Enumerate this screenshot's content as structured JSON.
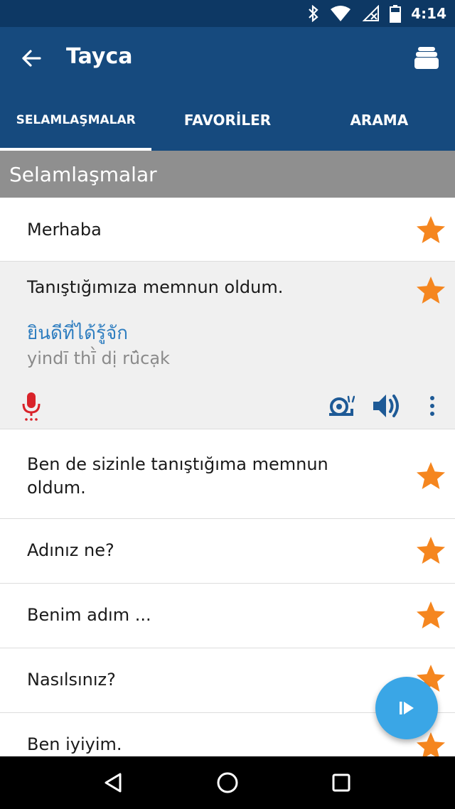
{
  "status_bar": {
    "time": "4:14"
  },
  "app_bar": {
    "title": "Tayca"
  },
  "tabs": [
    {
      "label": "SELAMLAŞMALAR",
      "active": true
    },
    {
      "label": "FAVORİLER",
      "active": false
    },
    {
      "label": "ARAMA",
      "active": false
    }
  ],
  "section_title": "Selamlaşmalar",
  "phrases": [
    {
      "text": "Merhaba"
    },
    {
      "text": "Tanıştığımıza memnun oldum.",
      "thai": "ยินดีที่ได้รู้จัก",
      "translit": "yindī thī̀ dị rū̂cạk"
    },
    {
      "text": "Ben de sizinle tanıştığıma memnun oldum."
    },
    {
      "text": "Adınız ne?"
    },
    {
      "text": "Benim adım ..."
    },
    {
      "text": "Nasılsınız?"
    },
    {
      "text": "Ben iyiyim."
    }
  ],
  "colors": {
    "status_bar": "#0d3864",
    "app_bar": "#164a7e",
    "section": "#8f8f8f",
    "star": "#f5861f",
    "thai_text": "#2f7ec0",
    "mic": "#d9232a",
    "action_icons": "#1e5a96",
    "fab": "#3aa6e6"
  },
  "icons": {
    "back": "arrow-left-icon",
    "menu": "stack-icon",
    "star": "star-icon",
    "mic": "microphone-icon",
    "slow": "snail-icon",
    "speaker": "speaker-icon",
    "more": "more-vertical-icon",
    "play": "play-icon"
  }
}
